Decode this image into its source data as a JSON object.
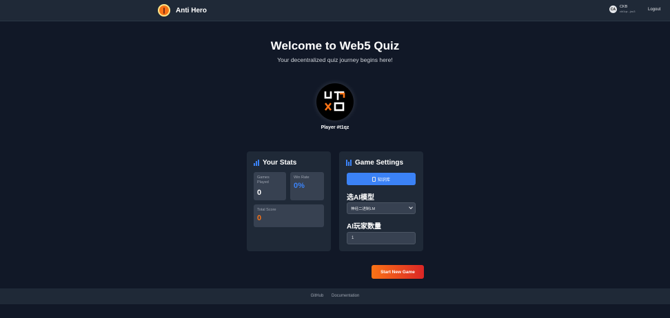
{
  "header": {
    "brand_name": "Anti Hero",
    "user_name": "CKB",
    "user_address": "ckt1qz...jnu3",
    "user_avatar_text": "CA",
    "logout_label": "Logout"
  },
  "hero": {
    "title": "Welcome to Web5 Quiz",
    "subtitle": "Your decentralized quiz journey begins here!"
  },
  "player": {
    "name": "Player #t1qz",
    "avatar_text": "UTXO"
  },
  "stats": {
    "title": "Your Stats",
    "games_played_label": "Games Played",
    "games_played_value": "0",
    "win_rate_label": "Win Rate",
    "win_rate_value": "0%",
    "total_score_label": "Total Score",
    "total_score_value": "0"
  },
  "settings": {
    "title": "Game Settings",
    "knowledge_button": "知识库",
    "ai_model_label": "选AI模型",
    "ai_model_selected": "神经二进制LM",
    "ai_player_count_label": "AI玩家数量",
    "ai_player_count_value": "1"
  },
  "actions": {
    "start_label": "Start New Game"
  },
  "footer": {
    "github": "GitHub",
    "documentation": "Documentation"
  },
  "colors": {
    "background": "#111827",
    "card": "#1f2937",
    "accent_blue": "#3b82f6",
    "accent_orange": "#f97316",
    "start_gradient_end": "#dc2626"
  },
  "icons": {
    "brand": "anti-hero-logo",
    "stats": "bar-chart-icon",
    "settings": "sliders-icon",
    "knowledge": "document-icon"
  }
}
